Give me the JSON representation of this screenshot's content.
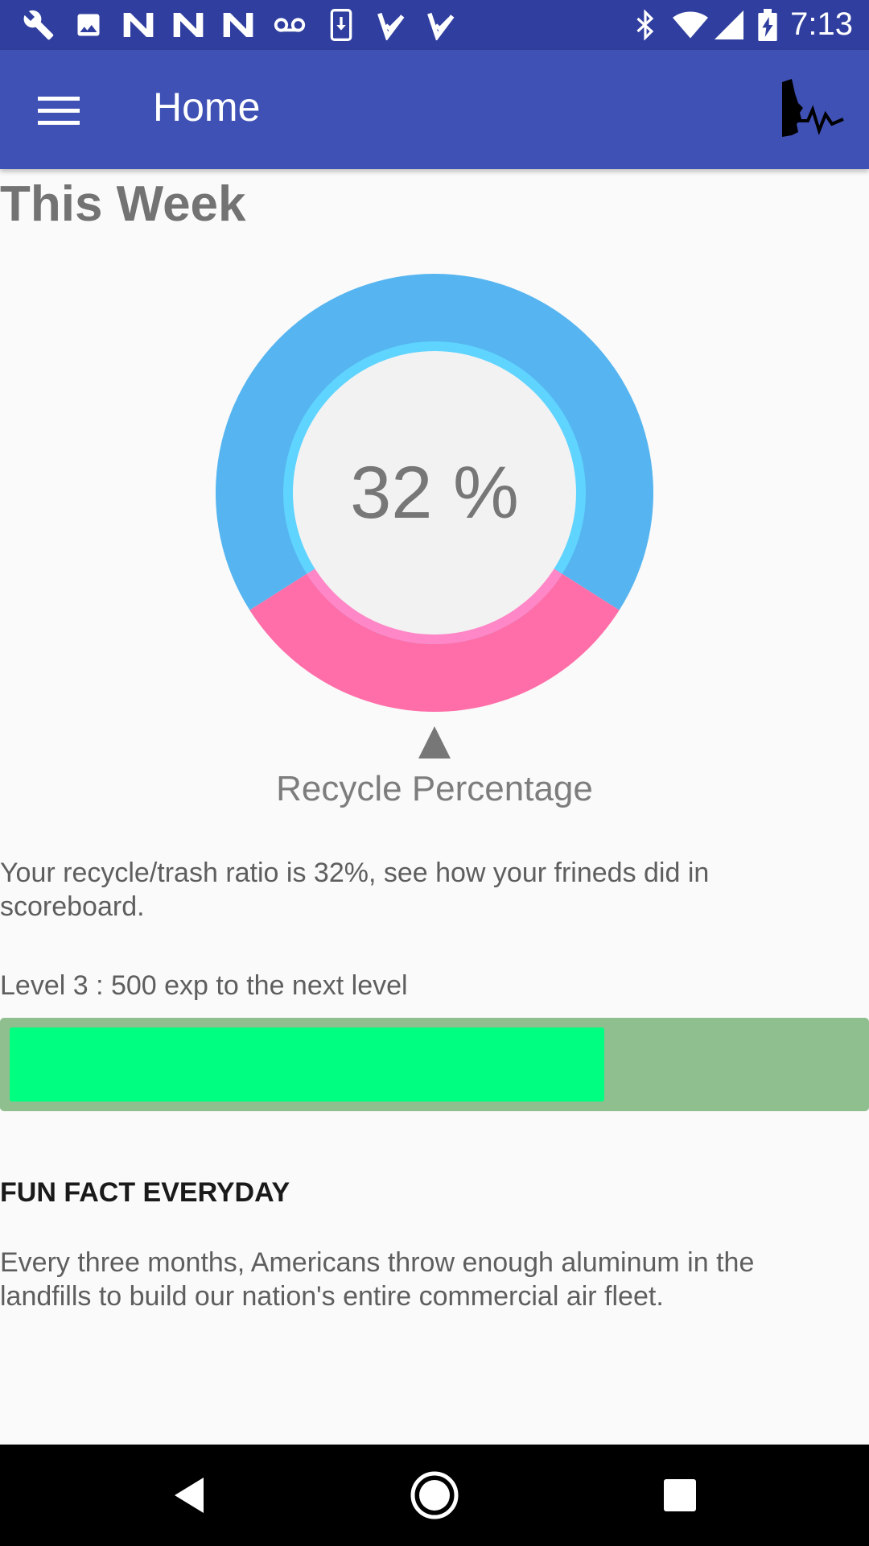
{
  "status_bar": {
    "time": "7:13",
    "left_icons": [
      "wrench-icon",
      "image-icon",
      "n-icon",
      "n-icon",
      "n-icon",
      "voicemail-icon",
      "download-icon",
      "check-icon",
      "check-icon"
    ],
    "right_icons": [
      "bluetooth-icon",
      "wifi-icon",
      "signal-icon",
      "battery-charging-icon"
    ]
  },
  "app_bar": {
    "title": "Home",
    "menu_icon": "hamburger-menu-icon",
    "logo_icon": "brand-logo-icon",
    "color": "#3f51b5"
  },
  "main": {
    "heading": "This Week",
    "gauge": {
      "value_text": "32 %",
      "value_percent": 32,
      "caption": "Recycle Percentage",
      "recycle_color": "#ff6ea8",
      "trash_color": "#56b5f0",
      "inner_ring_color": "#5fd4ff"
    },
    "ratio_text": "Your recycle/trash ratio is 32%, see how your frineds did in scoreboard.",
    "level_text": "Level 3 : 500 exp to the next level",
    "level_progress_fraction": 0.7,
    "fun_fact_heading": "FUN FACT EVERYDAY",
    "fun_fact_text": "Every three months, Americans throw enough aluminum in the landfills to build our nation's entire commercial air fleet."
  },
  "nav_bar": {
    "icons": [
      "back-icon",
      "home-icon",
      "recents-icon"
    ]
  }
}
